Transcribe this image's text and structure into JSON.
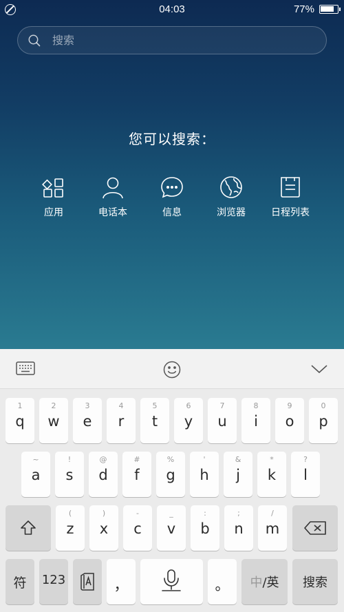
{
  "status_bar": {
    "time": "04:03",
    "battery": "77%"
  },
  "search": {
    "placeholder": "搜索"
  },
  "hint": "您可以搜索：",
  "categories": [
    {
      "label": "应用",
      "icon": "apps-grid-icon"
    },
    {
      "label": "电话本",
      "icon": "contacts-person-icon"
    },
    {
      "label": "信息",
      "icon": "message-bubble-icon"
    },
    {
      "label": "浏览器",
      "icon": "globe-browser-icon"
    },
    {
      "label": "日程列表",
      "icon": "calendar-note-icon"
    }
  ],
  "keyboard": {
    "toolbar": [
      "keyboard-icon",
      "emoji-icon",
      "chevron-down-icon"
    ],
    "row1": [
      {
        "sub": "1",
        "main": "q"
      },
      {
        "sub": "2",
        "main": "w"
      },
      {
        "sub": "3",
        "main": "e"
      },
      {
        "sub": "4",
        "main": "r"
      },
      {
        "sub": "5",
        "main": "t"
      },
      {
        "sub": "6",
        "main": "y"
      },
      {
        "sub": "7",
        "main": "u"
      },
      {
        "sub": "8",
        "main": "i"
      },
      {
        "sub": "9",
        "main": "o"
      },
      {
        "sub": "0",
        "main": "p"
      }
    ],
    "row2": [
      {
        "sub": "~",
        "main": "a"
      },
      {
        "sub": "!",
        "main": "s"
      },
      {
        "sub": "@",
        "main": "d"
      },
      {
        "sub": "#",
        "main": "f"
      },
      {
        "sub": "%",
        "main": "g"
      },
      {
        "sub": "'",
        "main": "h"
      },
      {
        "sub": "&",
        "main": "j"
      },
      {
        "sub": "*",
        "main": "k"
      },
      {
        "sub": "?",
        "main": "l"
      }
    ],
    "row3": [
      {
        "sub": "(",
        "main": "z"
      },
      {
        "sub": ")",
        "main": "x"
      },
      {
        "sub": "-",
        "main": "c"
      },
      {
        "sub": "_",
        "main": "v"
      },
      {
        "sub": ":",
        "main": "b"
      },
      {
        "sub": ";",
        "main": "n"
      },
      {
        "sub": "/",
        "main": "m"
      }
    ],
    "row4": {
      "symbols": "符",
      "numbers": "123",
      "comma": "，",
      "period": "。",
      "lang_zh": "中",
      "lang_sep": "/",
      "lang_en": "英",
      "search": "搜索"
    },
    "accent": "#3aa0e6"
  }
}
